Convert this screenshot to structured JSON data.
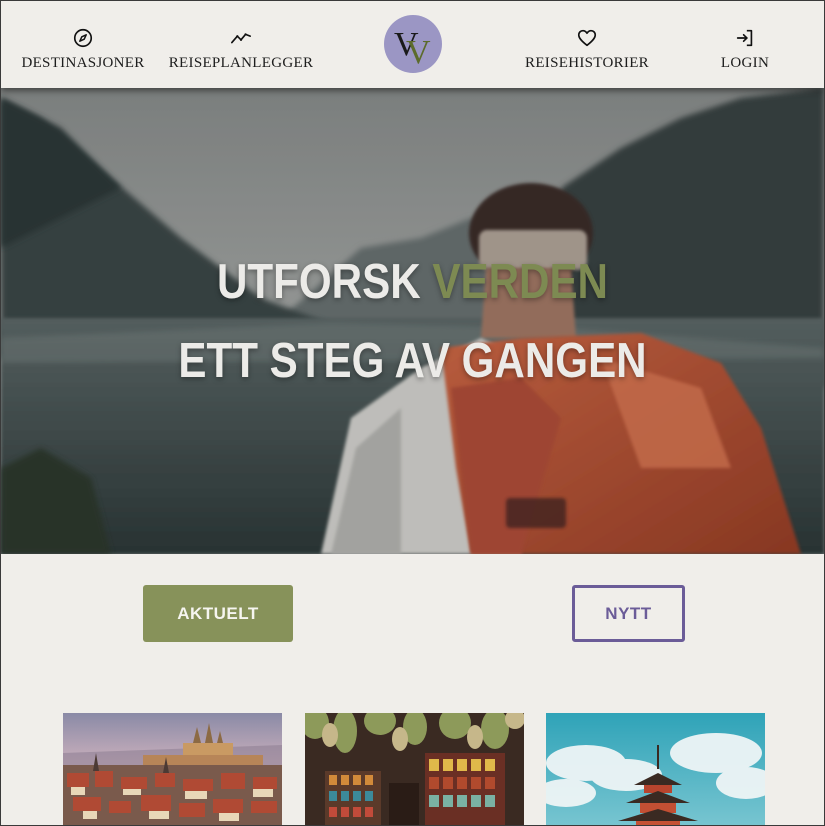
{
  "nav": {
    "items": [
      {
        "label": "DESTINASJONER",
        "icon": "compass-icon"
      },
      {
        "label": "REISEPLANLEGGER",
        "icon": "trend-line-icon"
      },
      {
        "label": "REISEHISTORIER",
        "icon": "heart-icon"
      },
      {
        "label": "LOGIN",
        "icon": "login-icon"
      }
    ],
    "logo": {
      "letters": "VV",
      "color": "#9b96c4"
    }
  },
  "hero": {
    "line1_part1": "UTFORSK",
    "line1_accent": "VERDEN",
    "line2": "ETT STEG AV GANGEN",
    "accent_color": "#7d8a52"
  },
  "buttons": {
    "aktuelt": "AKTUELT",
    "nytt": "NYTT",
    "primary_color": "#87925a",
    "secondary_color": "#6b5c98"
  },
  "cards": [
    {
      "image": "prague-castle-cityscape"
    },
    {
      "image": "spice-market-shop"
    },
    {
      "image": "japanese-pagoda"
    }
  ]
}
